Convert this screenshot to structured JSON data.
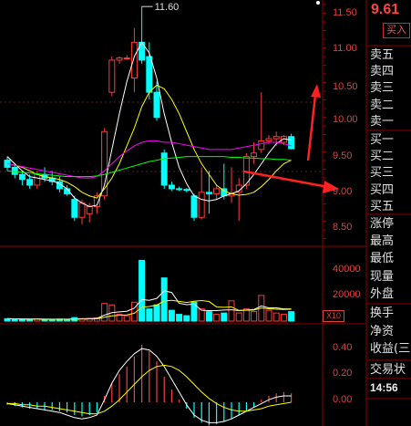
{
  "header": {
    "current_price": "9.61",
    "buy_button": "买入"
  },
  "candle_high_label": "11.60",
  "price_axis": [
    "11.50",
    "11.00",
    "10.50",
    "10.00",
    "9.50",
    "9.00",
    "8.50"
  ],
  "volume_axis": [
    "40000",
    "20000"
  ],
  "volume_unit": "X10",
  "macd_axis": [
    "0.40",
    "0.20",
    "0.00"
  ],
  "order_book": {
    "sell": [
      "卖五",
      "卖四",
      "卖三",
      "卖二",
      "卖一"
    ],
    "buy": [
      "买一",
      "买二",
      "买三",
      "买四",
      "买五"
    ]
  },
  "quote_fields": [
    "涨停",
    "最高",
    "最低",
    "现量",
    "外盘"
  ],
  "fund_fields": [
    "换手",
    "净资",
    "收益(三"
  ],
  "trade_detail": "交易状",
  "time": "14:56",
  "colors": {
    "up": "#ff3b3b",
    "down": "#00ffff",
    "ma5": "#ffffff",
    "ma10": "#ffff00",
    "ma20": "#ff00ff",
    "ma60": "#00ff00",
    "grid": "#8b0000"
  },
  "candles": [
    {
      "o": 9.45,
      "h": 9.5,
      "l": 9.3,
      "c": 9.35
    },
    {
      "o": 9.35,
      "h": 9.4,
      "l": 9.2,
      "c": 9.25
    },
    {
      "o": 9.25,
      "h": 9.3,
      "l": 9.1,
      "c": 9.18
    },
    {
      "o": 9.18,
      "h": 9.25,
      "l": 9.05,
      "c": 9.1
    },
    {
      "o": 9.1,
      "h": 9.3,
      "l": 9.05,
      "c": 9.25
    },
    {
      "o": 9.25,
      "h": 9.35,
      "l": 9.15,
      "c": 9.2
    },
    {
      "o": 9.2,
      "h": 9.3,
      "l": 9.1,
      "c": 9.15
    },
    {
      "o": 9.15,
      "h": 9.22,
      "l": 9.0,
      "c": 9.05
    },
    {
      "o": 9.05,
      "h": 9.1,
      "l": 8.95,
      "c": 8.98
    },
    {
      "o": 8.9,
      "h": 8.95,
      "l": 8.6,
      "c": 8.65
    },
    {
      "o": 8.65,
      "h": 8.9,
      "l": 8.55,
      "c": 8.85
    },
    {
      "o": 8.7,
      "h": 8.85,
      "l": 8.58,
      "c": 8.8
    },
    {
      "o": 8.8,
      "h": 9.0,
      "l": 8.7,
      "c": 8.95
    },
    {
      "o": 8.95,
      "h": 9.9,
      "l": 8.9,
      "c": 9.85
    },
    {
      "o": 10.4,
      "h": 10.9,
      "l": 10.35,
      "c": 10.85
    },
    {
      "o": 10.85,
      "h": 10.9,
      "l": 10.8,
      "c": 10.88
    },
    {
      "o": 10.88,
      "h": 10.92,
      "l": 10.85,
      "c": 10.88
    },
    {
      "o": 10.6,
      "h": 11.3,
      "l": 10.4,
      "c": 11.1
    },
    {
      "o": 11.1,
      "h": 11.6,
      "l": 10.8,
      "c": 10.85
    },
    {
      "o": 10.9,
      "h": 11.1,
      "l": 10.3,
      "c": 10.4
    },
    {
      "o": 10.4,
      "h": 10.55,
      "l": 10.0,
      "c": 10.05
    },
    {
      "o": 9.55,
      "h": 9.6,
      "l": 9.05,
      "c": 9.1
    },
    {
      "o": 9.1,
      "h": 9.15,
      "l": 9.02,
      "c": 9.05
    },
    {
      "o": 9.05,
      "h": 9.08,
      "l": 9.02,
      "c": 9.04
    },
    {
      "o": 9.04,
      "h": 9.06,
      "l": 9.0,
      "c": 9.03
    },
    {
      "o": 8.95,
      "h": 8.98,
      "l": 8.6,
      "c": 8.65
    },
    {
      "o": 8.65,
      "h": 9.35,
      "l": 8.62,
      "c": 9.0
    },
    {
      "o": 9.0,
      "h": 9.3,
      "l": 8.7,
      "c": 8.98
    },
    {
      "o": 8.98,
      "h": 9.1,
      "l": 8.9,
      "c": 9.05
    },
    {
      "o": 9.05,
      "h": 9.4,
      "l": 8.9,
      "c": 8.95
    },
    {
      "o": 8.95,
      "h": 9.35,
      "l": 8.85,
      "c": 8.98
    },
    {
      "o": 9.0,
      "h": 9.2,
      "l": 8.6,
      "c": 9.1
    },
    {
      "o": 9.1,
      "h": 9.55,
      "l": 9.05,
      "c": 9.5
    },
    {
      "o": 9.5,
      "h": 9.7,
      "l": 9.4,
      "c": 9.55
    },
    {
      "o": 9.6,
      "h": 10.4,
      "l": 9.55,
      "c": 9.72
    },
    {
      "o": 9.72,
      "h": 9.8,
      "l": 9.68,
      "c": 9.75
    },
    {
      "o": 9.75,
      "h": 9.85,
      "l": 9.65,
      "c": 9.78
    },
    {
      "o": 9.7,
      "h": 9.8,
      "l": 9.66,
      "c": 9.78
    },
    {
      "o": 9.78,
      "h": 9.82,
      "l": 9.6,
      "c": 9.61
    }
  ],
  "volumes": [
    1800,
    1500,
    1400,
    1300,
    1600,
    1200,
    1300,
    1500,
    1200,
    2600,
    1900,
    2000,
    2400,
    13000,
    12000,
    5000,
    4000,
    14000,
    45000,
    9000,
    12000,
    32000,
    8000,
    5000,
    4000,
    14000,
    9000,
    7000,
    5000,
    6000,
    15000,
    6000,
    9000,
    7000,
    19000,
    8000,
    6000,
    5000,
    7000
  ],
  "ma_lines": {
    "ma5": [
      9.5,
      9.4,
      9.3,
      9.22,
      9.2,
      9.18,
      9.16,
      9.12,
      9.05,
      8.92,
      8.85,
      8.8,
      8.82,
      9.1,
      9.6,
      10.1,
      10.55,
      10.9,
      11.1,
      10.95,
      10.6,
      10.1,
      9.7,
      9.35,
      9.12,
      8.95,
      8.9,
      8.88,
      8.9,
      8.95,
      8.98,
      9.02,
      9.12,
      9.25,
      9.4,
      9.55,
      9.68,
      9.75,
      9.73
    ],
    "ma10": [
      9.4,
      9.38,
      9.35,
      9.3,
      9.25,
      9.22,
      9.2,
      9.18,
      9.14,
      9.08,
      9.0,
      8.95,
      8.92,
      9.05,
      9.2,
      9.4,
      9.65,
      9.9,
      10.2,
      10.4,
      10.5,
      10.45,
      10.3,
      10.1,
      9.85,
      9.6,
      9.4,
      9.25,
      9.1,
      9.02,
      8.98,
      8.96,
      8.97,
      9.0,
      9.08,
      9.18,
      9.3,
      9.4,
      9.45
    ],
    "ma20": [
      9.4,
      9.38,
      9.36,
      9.34,
      9.32,
      9.3,
      9.28,
      9.26,
      9.24,
      9.22,
      9.2,
      9.2,
      9.22,
      9.3,
      9.4,
      9.5,
      9.58,
      9.65,
      9.7,
      9.72,
      9.72,
      9.7,
      9.7,
      9.68,
      9.66,
      9.64,
      9.62,
      9.6,
      9.6,
      9.6,
      9.6,
      9.62,
      9.64,
      9.66,
      9.68,
      9.7,
      9.7,
      9.68,
      9.65
    ],
    "ma60": [
      9.3,
      9.29,
      9.28,
      9.27,
      9.26,
      9.25,
      9.24,
      9.23,
      9.22,
      9.22,
      9.22,
      9.22,
      9.23,
      9.25,
      9.28,
      9.31,
      9.34,
      9.37,
      9.4,
      9.43,
      9.45,
      9.47,
      9.48,
      9.49,
      9.5,
      9.5,
      9.5,
      9.5,
      9.5,
      9.5,
      9.49,
      9.49,
      9.48,
      9.48,
      9.47,
      9.47,
      9.46,
      9.46,
      9.45
    ]
  },
  "macd": {
    "hist": [
      -0.02,
      -0.03,
      -0.04,
      -0.05,
      -0.05,
      -0.06,
      -0.06,
      -0.07,
      -0.08,
      -0.1,
      -0.11,
      -0.1,
      -0.08,
      0.05,
      0.15,
      0.22,
      0.28,
      0.36,
      0.45,
      0.4,
      0.32,
      0.2,
      0.1,
      0.02,
      -0.05,
      -0.12,
      -0.16,
      -0.18,
      -0.17,
      -0.15,
      -0.13,
      -0.1,
      -0.07,
      -0.04,
      0.02,
      0.05,
      0.07,
      0.08,
      0.07
    ],
    "dif": [
      -0.01,
      -0.02,
      -0.03,
      -0.04,
      -0.05,
      -0.06,
      -0.07,
      -0.08,
      -0.1,
      -0.12,
      -0.13,
      -0.12,
      -0.1,
      0.02,
      0.15,
      0.25,
      0.32,
      0.38,
      0.42,
      0.41,
      0.36,
      0.28,
      0.18,
      0.08,
      -0.02,
      -0.1,
      -0.14,
      -0.16,
      -0.16,
      -0.15,
      -0.13,
      -0.1,
      -0.07,
      -0.04,
      -0.01,
      0.02,
      0.04,
      0.05,
      0.05
    ],
    "dea": [
      -0.01,
      -0.01,
      -0.02,
      -0.02,
      -0.03,
      -0.03,
      -0.04,
      -0.05,
      -0.06,
      -0.07,
      -0.08,
      -0.09,
      -0.09,
      -0.07,
      -0.03,
      0.02,
      0.08,
      0.14,
      0.2,
      0.25,
      0.28,
      0.29,
      0.28,
      0.25,
      0.2,
      0.14,
      0.08,
      0.03,
      -0.01,
      -0.04,
      -0.06,
      -0.07,
      -0.07,
      -0.06,
      -0.05,
      -0.03,
      -0.02,
      -0.01,
      0.0
    ]
  }
}
